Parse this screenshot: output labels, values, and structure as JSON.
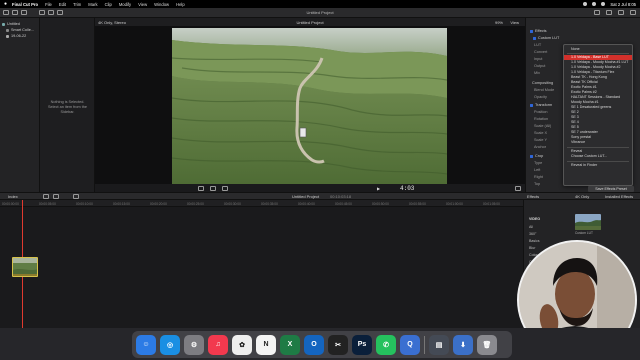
{
  "menubar": {
    "apple": "",
    "items": [
      "Final Cut Pro",
      "File",
      "Edit",
      "Trim",
      "Mark",
      "Clip",
      "Modify",
      "View",
      "Window",
      "Help"
    ],
    "datetime": "Sat 2 Jul 8:05"
  },
  "toolbar": {
    "title": "Untitled Project"
  },
  "library": {
    "items": [
      "Untitled",
      "Smart Colle...",
      "19-06-22"
    ]
  },
  "browser": {
    "empty_message": "Nothing is Selected.",
    "empty_sub": "Select an item from the Sidebar."
  },
  "viewer": {
    "format": "4K Only, Stereo",
    "title": "Untitled Project",
    "zoom": "99%",
    "view_label": "View",
    "timecode": "4:03"
  },
  "inspector": {
    "effects_label": "Effects",
    "custom_lut": "Custom LUT",
    "lut_label": "LUT",
    "convert_label": "Convert",
    "input_label": "Input",
    "output_label": "Output",
    "mix_label": "Mix",
    "compositing_label": "Compositing",
    "blend_mode_label": "Blend Mode",
    "opacity_label": "Opacity",
    "transform_label": "Transform",
    "position_label": "Position",
    "rotation_label": "Rotation",
    "scale_all_label": "Scale (All)",
    "scale_x_label": "Scale X",
    "scale_y_label": "Scale Y",
    "anchor_label": "Anchor",
    "crop_label": "Crop",
    "type_label": "Type",
    "left_label": "Left",
    "right_label": "Right",
    "top_label": "Top",
    "current_value": "None",
    "save_preset": "Save Effects Preset"
  },
  "lut_menu": {
    "items": [
      "None",
      "1.0 Veldaya - Base LUT",
      "1.0 Veldaya - Moody Mocha #1 LUT",
      "1.0 Veldaya - Moody Mocha #2",
      "1.0 Veldaya - Titanium Flex",
      "Beast TK - Hong Kong",
      "Beast TK Official",
      "Exotic Palms #1",
      "Exotic Palms #2",
      "HALTANT Sessions - Standard",
      "Moody Mocha #1",
      "SE 1 Desaturated greens",
      "SE 2",
      "SE 3",
      "SE 4",
      "SE 5",
      "SE 7 underwater",
      "Sony prestal",
      "Vibrance"
    ],
    "selected_index": 1,
    "reveal": "Reveal",
    "choose": "Choose Custom LUT...",
    "finder": "Reveal in Finder"
  },
  "timeline": {
    "index_label": "Index",
    "project_title": "Untitled Project",
    "duration": "00:10:03:18",
    "ruler_ticks": [
      "00:00:00:00",
      "00:00:05:00",
      "00:00:10:00",
      "00:00:15:00",
      "00:00:20:00",
      "00:00:25:00",
      "00:00:30:00",
      "00:00:35:00",
      "00:00:40:00",
      "00:00:45:00",
      "00:00:50:00",
      "00:00:55:00",
      "00:01:00:00",
      "00:01:05:00"
    ]
  },
  "effects_browser": {
    "header": "Effects",
    "all_only": "4K Only",
    "installed": "Installed Effects",
    "categories": [
      "VIDEO",
      "All",
      "360°",
      "Basics",
      "Blur",
      "Color",
      "Color Presets",
      "Comic Looks",
      "Distortion",
      "Keying",
      "Light",
      "Looks",
      "Masks",
      "Nostalgia"
    ],
    "fx_name": "Custom LUT"
  },
  "dock": {
    "apps": [
      {
        "name": "finder",
        "glyph": "☺",
        "color": "#2c7be5"
      },
      {
        "name": "safari",
        "glyph": "◎",
        "color": "#1a8fe3"
      },
      {
        "name": "system-preferences",
        "glyph": "⚙",
        "color": "#7d7d82"
      },
      {
        "name": "music",
        "glyph": "♫",
        "color": "#f2394e"
      },
      {
        "name": "photos",
        "glyph": "✿",
        "color": "#eeeeee"
      },
      {
        "name": "notion",
        "glyph": "N",
        "color": "#f4f4f4"
      },
      {
        "name": "excel",
        "glyph": "X",
        "color": "#1e7b45"
      },
      {
        "name": "outlook",
        "glyph": "O",
        "color": "#1465c0"
      },
      {
        "name": "final-cut-pro",
        "glyph": "✂",
        "color": "#222222"
      },
      {
        "name": "photoshop",
        "glyph": "Ps",
        "color": "#0a1f3a"
      },
      {
        "name": "whatsapp",
        "glyph": "✆",
        "color": "#25c15e"
      },
      {
        "name": "quicktime",
        "glyph": "Q",
        "color": "#3a6fd1"
      },
      {
        "name": "preview",
        "glyph": "▤",
        "color": "#444a55"
      },
      {
        "name": "downloads",
        "glyph": "⬇",
        "color": "#3b70c8"
      },
      {
        "name": "trash",
        "glyph": "🗑",
        "color": "#8a8a8f"
      }
    ]
  }
}
